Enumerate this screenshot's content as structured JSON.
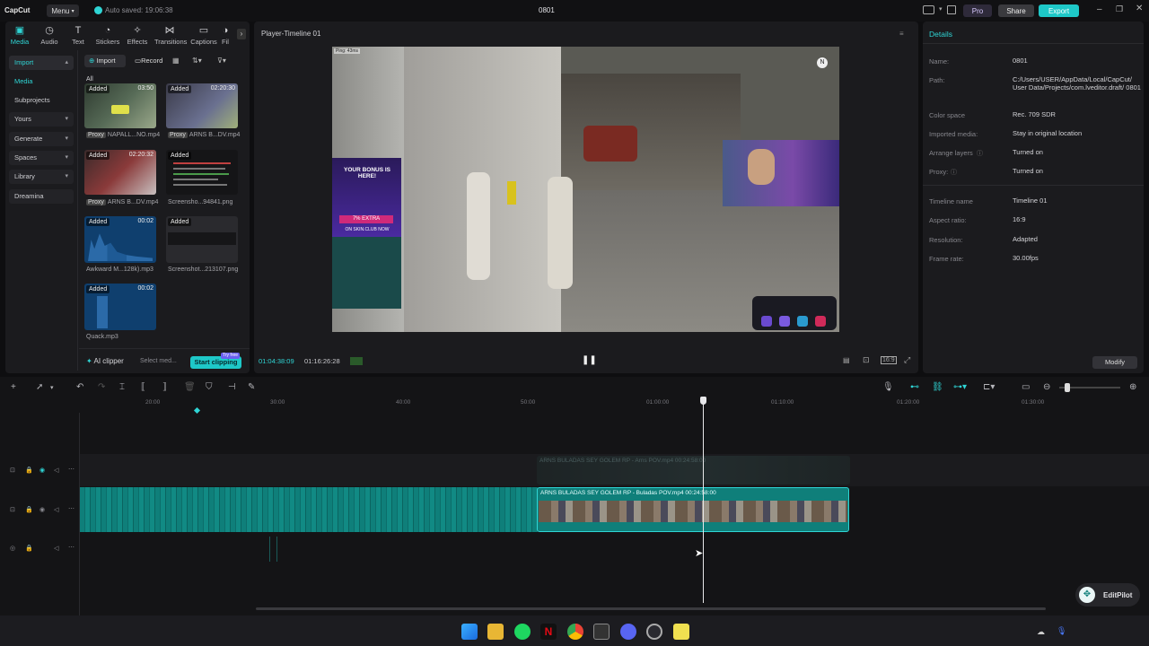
{
  "titlebar": {
    "app_name": "CapCut",
    "menu_label": "Menu",
    "autosave": "Auto saved: 19:06:38",
    "project_title": "0801",
    "pro_label": "Pro",
    "share_label": "Share",
    "export_label": "Export"
  },
  "toolbar_tabs": [
    "Media",
    "Audio",
    "Text",
    "Stickers",
    "Effects",
    "Transitions",
    "Captions",
    "Fil"
  ],
  "sidebar": {
    "items": [
      {
        "label": "Import"
      },
      {
        "label": "Media"
      },
      {
        "label": "Subprojects"
      },
      {
        "label": "Yours"
      },
      {
        "label": "Generate"
      },
      {
        "label": "Spaces"
      },
      {
        "label": "Library"
      },
      {
        "label": "Dreamina"
      }
    ]
  },
  "media": {
    "import_label": "Import",
    "record_label": "Record",
    "filter_all": "All",
    "items": [
      {
        "tag": "Added",
        "duration": "03:50",
        "proxy": "Proxy",
        "name": "NAPALL...NO.mp4"
      },
      {
        "tag": "Added",
        "duration": "02:20:30",
        "proxy": "Proxy",
        "name": "ARNS B...DV.mp4"
      },
      {
        "tag": "Added",
        "duration": "02:20:32",
        "proxy": "Proxy",
        "name": "ARNS B...DV.mp4"
      },
      {
        "tag": "Added",
        "duration": "",
        "proxy": "",
        "name": "Screensho...94841.png"
      },
      {
        "tag": "Added",
        "duration": "00:02",
        "proxy": "",
        "name": "Awkward M...128k).mp3"
      },
      {
        "tag": "Added",
        "duration": "",
        "proxy": "",
        "name": "Screenshot...213107.png"
      },
      {
        "tag": "Added",
        "duration": "00:02",
        "proxy": "",
        "name": "Quack.mp3"
      }
    ],
    "ai_clipper": "AI clipper",
    "select_media": "Select med...",
    "start_clipping": "Start clipping",
    "try_free": "Try free"
  },
  "player": {
    "title": "Player-Timeline 01",
    "current_time": "01:04:38:09",
    "total_time": "01:16:26:28",
    "overlay_ping": "Ping: 43ms",
    "overlay_bonus_title": "YOUR BONUS IS HERE!",
    "overlay_extra": "7% EXTRA",
    "overlay_site": "ON SKIN.CLUB NOW"
  },
  "details": {
    "title": "Details",
    "rows": [
      {
        "label": "Name:",
        "value": "0801"
      },
      {
        "label": "Path:",
        "value": "C:/Users/USER/AppData/Local/CapCut/ User Data/Projects/com.lveditor.draft/ 0801"
      },
      {
        "label": "Color space",
        "value": "Rec. 709 SDR"
      },
      {
        "label": "Imported media:",
        "value": "Stay in original location"
      },
      {
        "label": "Arrange layers",
        "value": "Turned on"
      },
      {
        "label": "Proxy:",
        "value": "Turned on"
      },
      {
        "label": "Timeline name",
        "value": "Timeline 01"
      },
      {
        "label": "Aspect ratio:",
        "value": "16:9"
      },
      {
        "label": "Resolution:",
        "value": "Adapted"
      },
      {
        "label": "Frame rate:",
        "value": "30.00fps"
      }
    ],
    "modify_label": "Modify"
  },
  "timeline": {
    "ruler": [
      "20:00",
      "30:00",
      "40:00",
      "50:00",
      "01:00:00",
      "01:10:00",
      "01:20:00",
      "01:30:00"
    ],
    "clip_ghost_label": "ARNS BULADAS SEY GOLEM RP - Arns POV.mp4   00:24:58:00",
    "clip_label": "ARNS BULADAS SEY GOLEM RP - Buladas  POV.mp4   00:24:58:00",
    "editpilot_label": "EditPilot"
  },
  "colors": {
    "accent": "#2fd5d5",
    "export": "#1ec8c8",
    "clip": "#0f7f7a"
  }
}
